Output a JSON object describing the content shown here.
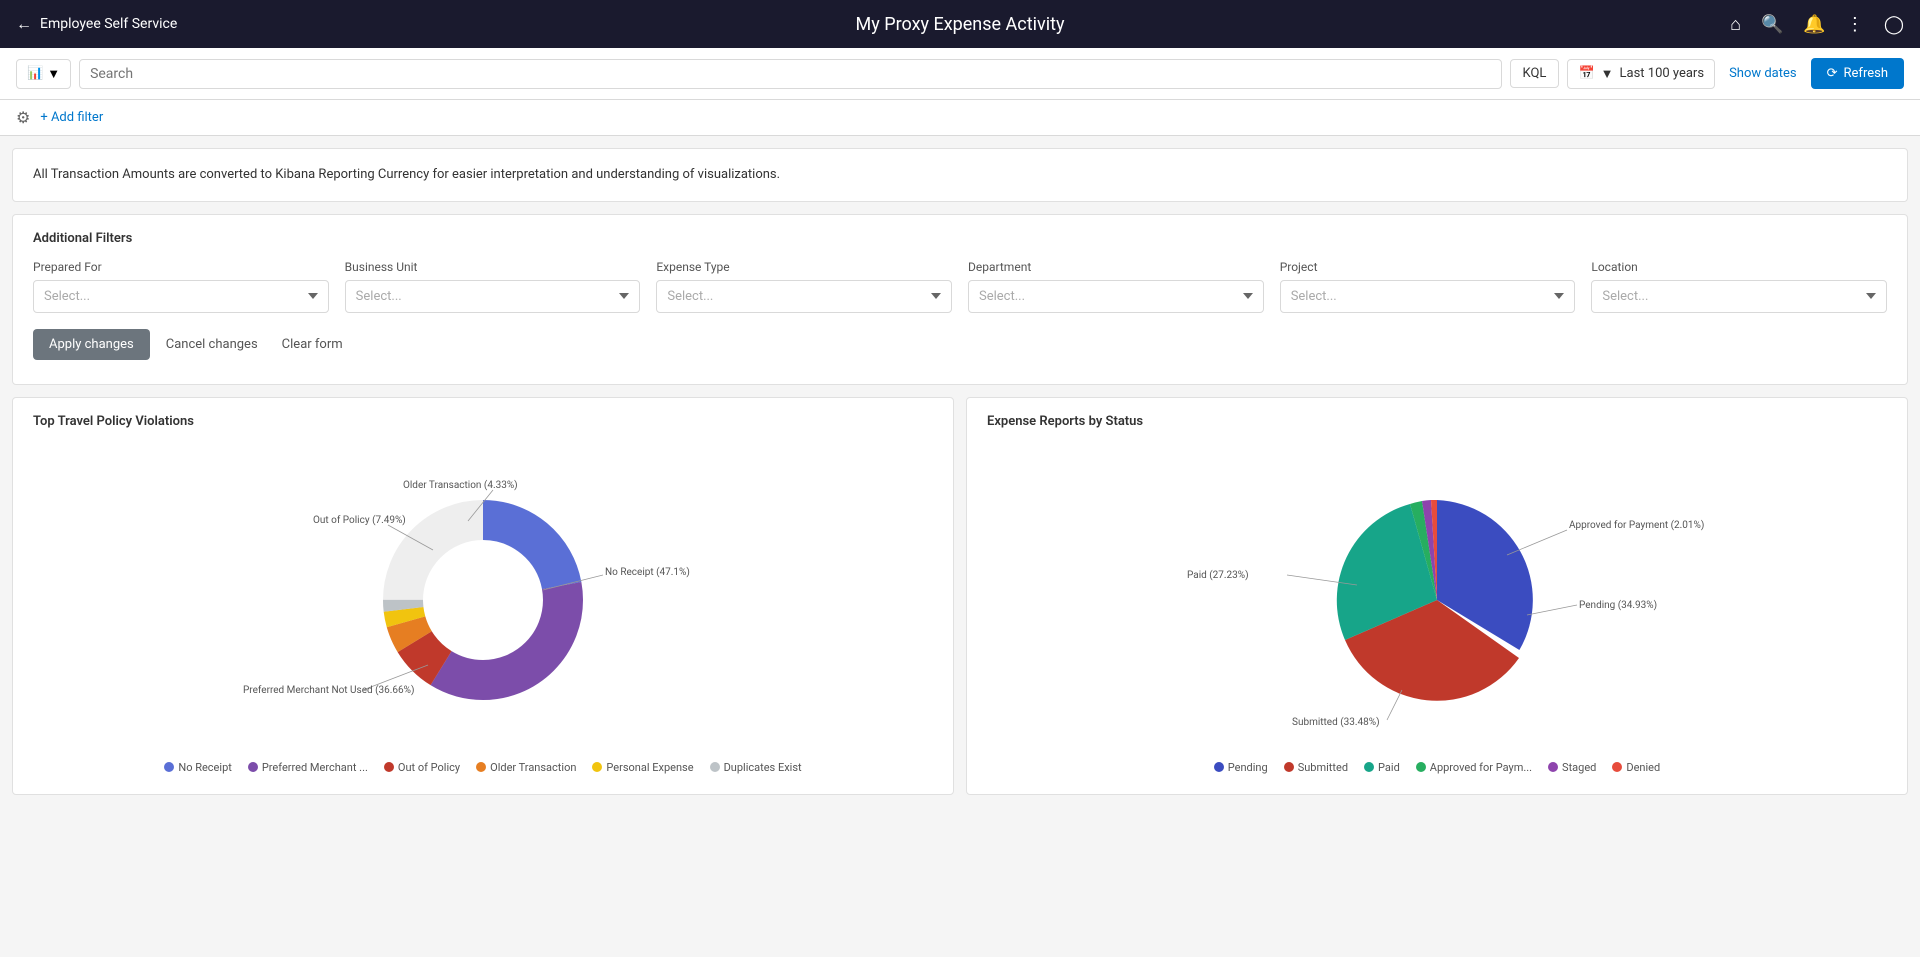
{
  "topNav": {
    "backLabel": "Employee Self Service",
    "title": "My Proxy Expense Activity",
    "icons": [
      "home",
      "search",
      "bell",
      "menu",
      "close-circle"
    ]
  },
  "searchBar": {
    "searchTypeBtnLabel": "🗂",
    "searchPlaceholder": "Search",
    "kqlLabel": "KQL",
    "dateRangeLabel": "Last 100 years",
    "showDatesLabel": "Show dates",
    "refreshLabel": "Refresh"
  },
  "filterRow": {
    "addFilterLabel": "+ Add filter"
  },
  "infoBanner": {
    "text": "All Transaction Amounts are converted to Kibana Reporting Currency for easier interpretation and understanding of visualizations."
  },
  "additionalFilters": {
    "title": "Additional Filters",
    "fields": [
      {
        "label": "Prepared For",
        "placeholder": "Select..."
      },
      {
        "label": "Business Unit",
        "placeholder": "Select..."
      },
      {
        "label": "Expense Type",
        "placeholder": "Select..."
      },
      {
        "label": "Department",
        "placeholder": "Select..."
      },
      {
        "label": "Project",
        "placeholder": "Select..."
      },
      {
        "label": "Location",
        "placeholder": "Select..."
      }
    ],
    "applyLabel": "Apply changes",
    "cancelLabel": "Cancel changes",
    "clearLabel": "Clear form"
  },
  "charts": {
    "left": {
      "title": "Top Travel Policy Violations",
      "segments": [
        {
          "label": "No Receipt",
          "percent": 47.1,
          "color": "#5a6fd6",
          "legendColor": "#5a6fd6"
        },
        {
          "label": "Preferred Merchant Not Used",
          "percent": 36.66,
          "color": "#7c4daa",
          "legendColor": "#7c4daa"
        },
        {
          "label": "Out of Policy",
          "percent": 7.49,
          "color": "#c0392b",
          "legendColor": "#c0392b"
        },
        {
          "label": "Older Transaction",
          "percent": 4.33,
          "color": "#e67e22",
          "legendColor": "#e67e22"
        },
        {
          "label": "Personal Expense",
          "percent": 2.52,
          "color": "#f1c40f",
          "legendColor": "#f1c40f"
        },
        {
          "label": "Duplicates Exist",
          "percent": 1.9,
          "color": "#bdc3c7",
          "legendColor": "#bdc3c7"
        }
      ],
      "legend": [
        {
          "label": "No Receipt",
          "color": "#5a6fd6"
        },
        {
          "label": "Preferred Merchant ...",
          "color": "#7c4daa"
        },
        {
          "label": "Out of Policy",
          "color": "#c0392b"
        },
        {
          "label": "Older Transaction",
          "color": "#e67e22"
        },
        {
          "label": "Personal Expense",
          "color": "#f1c40f"
        },
        {
          "label": "Duplicates Exist",
          "color": "#bdc3c7"
        }
      ]
    },
    "right": {
      "title": "Expense Reports by Status",
      "segments": [
        {
          "label": "Pending",
          "percent": 34.93,
          "color": "#3b4cc0"
        },
        {
          "label": "Submitted",
          "percent": 33.48,
          "color": "#c0392b"
        },
        {
          "label": "Paid",
          "percent": 27.23,
          "color": "#17a589"
        },
        {
          "label": "Approved for Payment",
          "percent": 2.01,
          "color": "#27ae60"
        },
        {
          "label": "Staged",
          "percent": 1.45,
          "color": "#8e44ad"
        },
        {
          "label": "Denied",
          "percent": 0.9,
          "color": "#e74c3c"
        }
      ],
      "legend": [
        {
          "label": "Pending",
          "color": "#3b4cc0"
        },
        {
          "label": "Submitted",
          "color": "#c0392b"
        },
        {
          "label": "Paid",
          "color": "#17a589"
        },
        {
          "label": "Approved for Paym...",
          "color": "#27ae60"
        },
        {
          "label": "Staged",
          "color": "#8e44ad"
        },
        {
          "label": "Denied",
          "color": "#e74c3c"
        }
      ]
    }
  }
}
